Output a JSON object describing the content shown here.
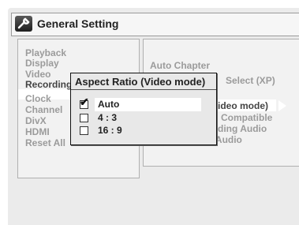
{
  "header": {
    "title": "General Setting",
    "icon": "wrench-icon"
  },
  "menu": {
    "items": [
      {
        "label": "Playback",
        "active": false
      },
      {
        "label": "Display",
        "active": false
      },
      {
        "label": "Video",
        "active": false
      },
      {
        "label": "Recording",
        "active": true
      },
      {
        "label": "Clock",
        "active": false
      },
      {
        "label": "Channel",
        "active": false
      },
      {
        "label": "DivX",
        "active": false
      },
      {
        "label": "HDMI",
        "active": false
      },
      {
        "label": "Reset All",
        "active": false
      }
    ]
  },
  "submenu": {
    "items": [
      {
        "label": "Auto Chapter"
      },
      {
        "label": "Select (XP)"
      },
      {
        "label": "ideo mode)"
      },
      {
        "label": "Compatible"
      },
      {
        "label": "ding Audio"
      },
      {
        "label": "External Input Audio"
      }
    ]
  },
  "dialog": {
    "title": "Aspect Ratio (Video mode)",
    "options": [
      {
        "label": "Auto",
        "checked": true
      },
      {
        "label": "4 : 3",
        "checked": false
      },
      {
        "label": "16 : 9",
        "checked": false
      }
    ],
    "check_glyph": "✔"
  },
  "colors": {
    "background": "#ebebeb",
    "inactive_text": "#9b9b9b",
    "active_text": "#222222",
    "highlight": "#ffffff"
  }
}
